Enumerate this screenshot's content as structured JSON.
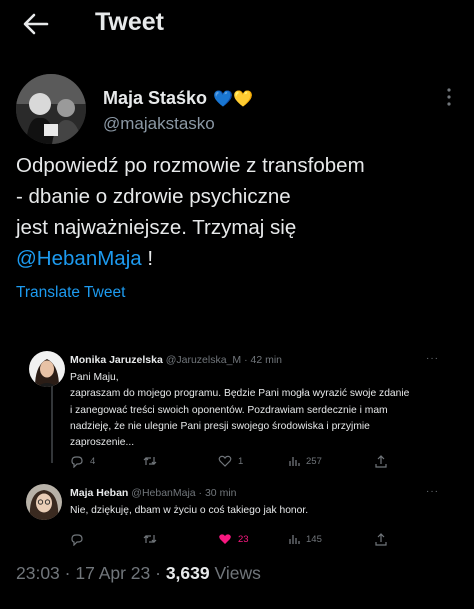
{
  "header": {
    "title": "Tweet",
    "back_icon": "arrow-left-icon"
  },
  "author": {
    "name": "Maja Staśko",
    "emoji": "💙💛",
    "handle": "@majakstasko"
  },
  "tweet": {
    "text_line1": "Odpowiedź po rozmowie z transfobem",
    "text_line2": "- dbanie o zdrowie psychiczne",
    "text_line3": "jest najważniejsze. Trzymaj się",
    "mention": "@HebanMaja",
    "text_end": " !",
    "translate": "Translate Tweet"
  },
  "quoted": {
    "reply1": {
      "name": "Monika Jaruzelska",
      "meta": "@Jaruzelska_M · 42 min",
      "more": "···",
      "line1": "Pani Maju,",
      "line2": "zapraszam do mojego programu. Będzie Pani mogła wyrazić swoje zdanie",
      "line3": "i zanegować treści swoich oponentów. Pozdrawiam serdecznie  i mam",
      "line4": "nadzieję, że nie ulegnie Pani presji swojego środowiska i przyjmie",
      "line5": "zaproszenie...",
      "replies": "4",
      "likes": "1",
      "views": "257"
    },
    "reply2": {
      "name": "Maja Heban",
      "meta": "@HebanMaja · 30 min",
      "more": "···",
      "line1": "Nie, dziękuję, dbam w życiu o coś takiego jak honor.",
      "likes": "23",
      "views": "145",
      "like_color": "#f91880"
    }
  },
  "footer": {
    "time": "23:03 · 17 Apr 23 · ",
    "views_count": "3,639",
    "views_label": " Views"
  },
  "colors": {
    "accent": "#1d9bf0",
    "muted": "#71767b",
    "like": "#f91880"
  }
}
